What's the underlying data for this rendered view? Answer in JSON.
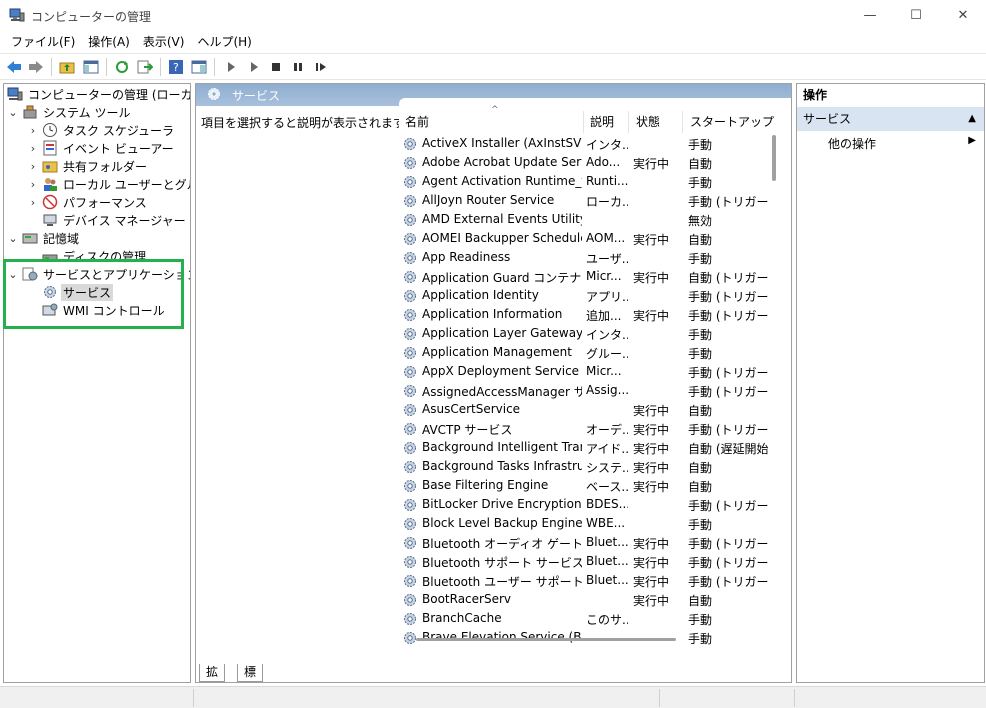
{
  "window": {
    "title": "コンピューターの管理",
    "minimize": "—",
    "maximize": "☐",
    "close": "✕"
  },
  "menu": [
    "ファイル(F)",
    "操作(A)",
    "表示(V)",
    "ヘルプ(H)"
  ],
  "toolbar_icons": [
    "back-icon",
    "forward-icon",
    "up-folder-icon",
    "show-hide-tree-icon",
    "refresh-icon",
    "export-icon",
    "help-icon",
    "properties-icon",
    "play-icon",
    "play-alt-icon",
    "stop-icon",
    "pause-icon",
    "resume-icon"
  ],
  "tree": [
    {
      "label": "コンピューターの管理 (ローカル)",
      "icon": "computer-management-icon",
      "level": 0,
      "expander": ""
    },
    {
      "label": "システム ツール",
      "icon": "tools-icon",
      "level": 1,
      "expander": "⌄"
    },
    {
      "label": "タスク スケジューラ",
      "icon": "clock-icon",
      "level": 2,
      "expander": "›"
    },
    {
      "label": "イベント ビューアー",
      "icon": "event-viewer-icon",
      "level": 2,
      "expander": "›"
    },
    {
      "label": "共有フォルダー",
      "icon": "shared-folder-icon",
      "level": 2,
      "expander": "›"
    },
    {
      "label": "ローカル ユーザーとグループ",
      "icon": "users-icon",
      "level": 2,
      "expander": "›"
    },
    {
      "label": "パフォーマンス",
      "icon": "performance-icon",
      "level": 2,
      "expander": "›"
    },
    {
      "label": "デバイス マネージャー",
      "icon": "device-manager-icon",
      "level": 2,
      "expander": ""
    },
    {
      "label": "記憶域",
      "icon": "storage-icon",
      "level": 1,
      "expander": "⌄"
    },
    {
      "label": "ディスクの管理",
      "icon": "disk-icon",
      "level": 2,
      "expander": ""
    },
    {
      "label": "サービスとアプリケーション",
      "icon": "services-apps-icon",
      "level": 1,
      "expander": "⌄"
    },
    {
      "label": "サービス",
      "icon": "gear-icon",
      "level": 2,
      "expander": "",
      "selected": true
    },
    {
      "label": "WMI コントロール",
      "icon": "wmi-icon",
      "level": 2,
      "expander": ""
    }
  ],
  "center": {
    "header": "サービス",
    "description": "項目を選択すると説明が表示されます。",
    "columns": [
      "名前",
      "説明",
      "状態",
      "スタートアップの種"
    ],
    "sort_indicator": "^",
    "rows": [
      [
        "ActiveX Installer (AxInstSV)",
        "インタ...",
        "",
        "手動"
      ],
      [
        "Adobe Acrobat Update Serv...",
        "Ado...",
        "実行中",
        "自動"
      ],
      [
        "Agent Activation Runtime_f...",
        "Runti...",
        "",
        "手動"
      ],
      [
        "AllJoyn Router Service",
        "ローカ...",
        "",
        "手動 (トリガー開"
      ],
      [
        "AMD External Events Utility",
        "",
        "",
        "無効"
      ],
      [
        "AOMEI Backupper Schedule...",
        "AOM...",
        "実行中",
        "自動"
      ],
      [
        "App Readiness",
        "ユーザ...",
        "",
        "手動"
      ],
      [
        "Application Guard コンテナー ...",
        "Micr...",
        "実行中",
        "自動 (トリガー開"
      ],
      [
        "Application Identity",
        "アプリ...",
        "",
        "手動 (トリガー開"
      ],
      [
        "Application Information",
        "追加...",
        "実行中",
        "手動 (トリガー開"
      ],
      [
        "Application Layer Gateway ...",
        "インタ...",
        "",
        "手動"
      ],
      [
        "Application Management",
        "グルー...",
        "",
        "手動"
      ],
      [
        "AppX Deployment Service (...",
        "Micr...",
        "",
        "手動 (トリガー開"
      ],
      [
        "AssignedAccessManager サ...",
        "Assig...",
        "",
        "手動 (トリガー開"
      ],
      [
        "AsusCertService",
        "",
        "実行中",
        "自動"
      ],
      [
        "AVCTP サービス",
        "オーデ...",
        "実行中",
        "手動 (トリガー開"
      ],
      [
        "Background Intelligent Tran...",
        "アイド...",
        "実行中",
        "自動 (遅延開始"
      ],
      [
        "Background Tasks Infrastruc...",
        "システ...",
        "実行中",
        "自動"
      ],
      [
        "Base Filtering Engine",
        "ベース...",
        "実行中",
        "自動"
      ],
      [
        "BitLocker Drive Encryption ...",
        "BDES...",
        "",
        "手動 (トリガー開"
      ],
      [
        "Block Level Backup Engine ...",
        "WBE...",
        "",
        "手動"
      ],
      [
        "Bluetooth オーディオ ゲートウェ...",
        "Bluet...",
        "実行中",
        "手動 (トリガー開"
      ],
      [
        "Bluetooth サポート サービス",
        "Bluet...",
        "実行中",
        "手動 (トリガー開"
      ],
      [
        "Bluetooth ユーザー サポート サ...",
        "Bluet...",
        "実行中",
        "手動 (トリガー開"
      ],
      [
        "BootRacerServ",
        "",
        "実行中",
        "自動"
      ],
      [
        "BranchCache",
        "このサ...",
        "",
        "手動"
      ],
      [
        "Brave Elevation Service (Bra...",
        "",
        "",
        "手動"
      ]
    ],
    "tabs": [
      "拡張",
      "標準"
    ]
  },
  "actions": {
    "title": "操作",
    "section": "サービス",
    "section_arrow": "▲",
    "item": "他の操作",
    "item_arrow": "▶"
  },
  "colors": {
    "highlight_box": "#22b14c",
    "header_blue": "#8faed0",
    "action_section": "#d8e4f2"
  }
}
